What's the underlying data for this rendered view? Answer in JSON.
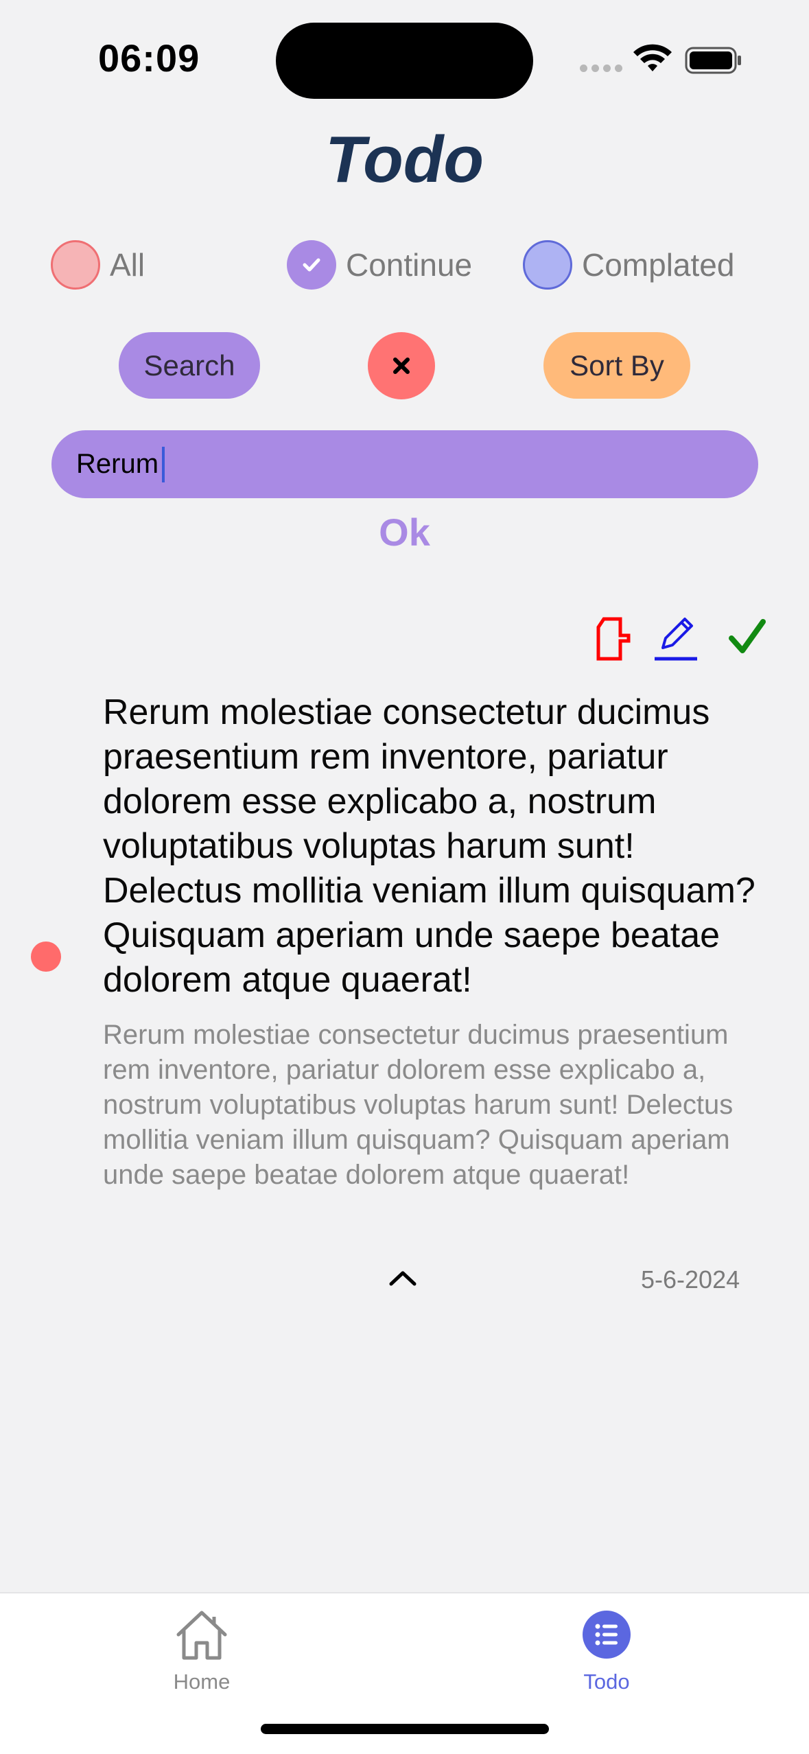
{
  "status_bar": {
    "time": "06:09"
  },
  "header": {
    "title": "Todo"
  },
  "filters": [
    {
      "label": "All",
      "selected": false,
      "color": "#f6b4b6"
    },
    {
      "label": "Continue",
      "selected": true,
      "color": "#a98ae4"
    },
    {
      "label": "Complated",
      "selected": false,
      "color": "#aeb3f3"
    }
  ],
  "actions": {
    "search_label": "Search",
    "clear_icon": "close-icon",
    "sort_label": "Sort By"
  },
  "search": {
    "value": "Rerum",
    "ok_label": "Ok"
  },
  "todo": {
    "status_color": "#ff6b6b",
    "title": "Rerum molestiae consectetur ducimus praesentium rem inventore, pariatur dolorem esse explicabo a, nostrum voluptatibus voluptas harum sunt! Delectus mollitia veniam illum quisquam? Quisquam aperiam unde saepe beatae dolorem atque quaerat!",
    "description": "Rerum molestiae consectetur ducimus praesentium rem inventore, pariatur dolorem esse explicabo a, nostrum voluptatibus voluptas harum sunt! Delectus mollitia veniam illum quisquam? Quisquam aperiam unde saepe beatae dolorem atque quaerat!",
    "date": "5-6-2024",
    "action_icons": [
      "delete-icon",
      "edit-icon",
      "checkmark-icon"
    ]
  },
  "tabbar": {
    "tabs": [
      {
        "label": "Home",
        "active": false
      },
      {
        "label": "Todo",
        "active": true
      }
    ]
  },
  "colors": {
    "accent": "#a98ae4",
    "title": "#1c3354",
    "danger": "#ff7373",
    "sort": "#ffba7a",
    "tab_active": "#5b67e0"
  }
}
